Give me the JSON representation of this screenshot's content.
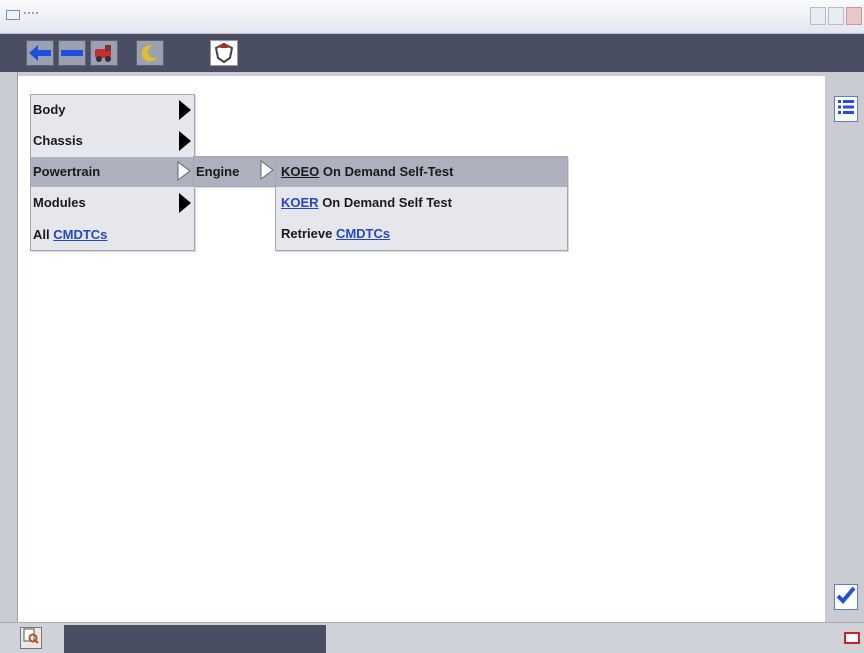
{
  "menu_main": {
    "items": [
      {
        "label": "Body",
        "has_submenu": true
      },
      {
        "label": "Chassis",
        "has_submenu": true
      },
      {
        "label": "Powertrain",
        "has_submenu": true,
        "active": true
      },
      {
        "label": "Modules",
        "has_submenu": true
      }
    ],
    "all_prefix": "All",
    "all_link": "CMDTCs"
  },
  "menu_powertrain": {
    "items": [
      {
        "label": "Engine",
        "has_submenu": true,
        "active": true
      }
    ]
  },
  "menu_engine": {
    "koeo_abbr": "KOEO",
    "koeo_rest": "On Demand Self-Test",
    "koer_abbr": "KOER",
    "koer_rest": "On Demand Self Test",
    "retrieve_prefix": "Retrieve",
    "retrieve_link": "CMDTCs"
  },
  "toolbar": {
    "icons": [
      "back-arrow-icon",
      "minus-icon",
      "vehicle-tool-icon",
      "moon-icon",
      "shield-icon"
    ]
  },
  "sidebar": {
    "icons": [
      "list-icon",
      "checkmark-icon"
    ]
  },
  "colors": {
    "toolbar_bg": "#494e62",
    "menu_bg": "#e6e7ec",
    "active_bg": "#aeb1bd",
    "link": "#2646c8"
  }
}
